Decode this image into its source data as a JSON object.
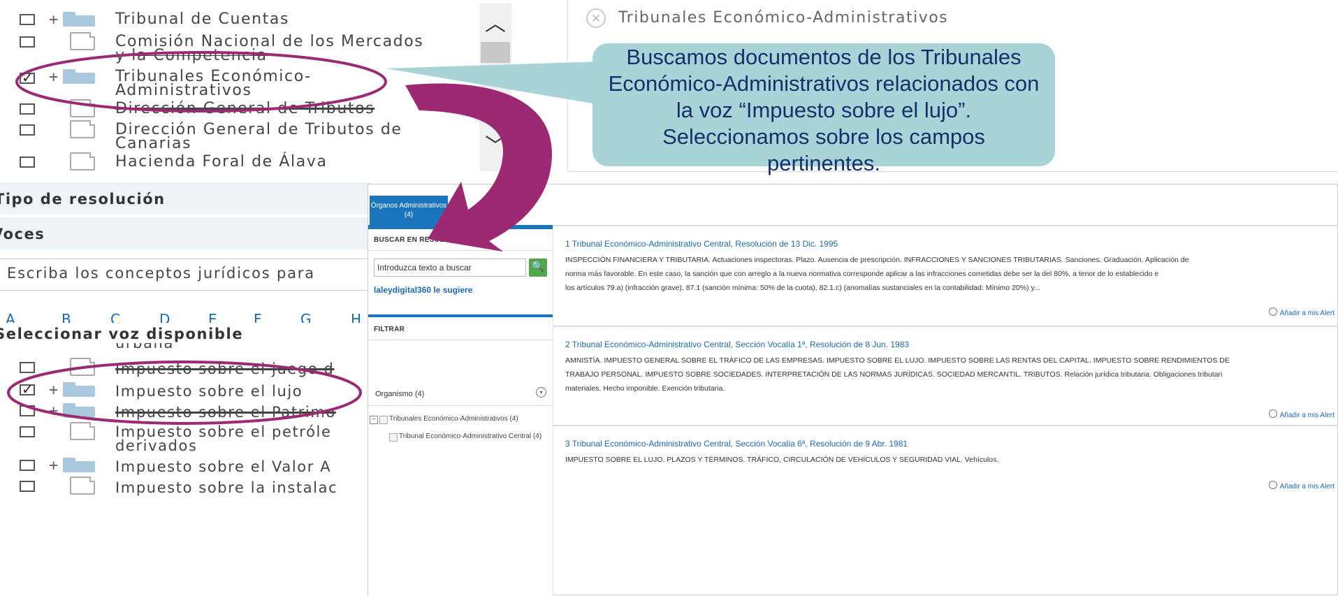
{
  "tree": {
    "items": [
      {
        "label": "Tribunal de Cuentas",
        "label2": ""
      },
      {
        "label": "Comisión Nacional de los Mercados",
        "label2": "y la Competencia"
      },
      {
        "label": "Tribunales Económico-",
        "label2": "Administrativos"
      },
      {
        "label": "Dirección General de Tributos",
        "label2": ""
      },
      {
        "label": "Dirección General de Tributos de",
        "label2": "Canarias"
      },
      {
        "label": "Hacienda Foral de Álava",
        "label2": ""
      }
    ],
    "plus": "+"
  },
  "scroll": {
    "up": "︿",
    "down": "﹀"
  },
  "chip": {
    "close": "✕",
    "label": "Tribunales Económico-Administrativos"
  },
  "callout": {
    "lines": [
      "Buscamos documentos de los Tribunales",
      "Económico-Administrativos relacionados con",
      "la voz “Impuesto sobre el lujo”.",
      "Seleccionamos sobre los campos",
      "pertinentes."
    ]
  },
  "filters": {
    "tipo": "Tipo de resolución",
    "voces": "Voces",
    "concepts_placeholder": "Escriba los conceptos jurídicos para",
    "alphabet": [
      "A",
      "B",
      "C",
      "D",
      "E",
      "F",
      "G",
      "H"
    ],
    "select_voz": "Seleccionar voz disponible",
    "voz_items": [
      {
        "label": "urbana"
      },
      {
        "label": "Impuesto sobre el juego d"
      },
      {
        "label": "Impuesto sobre el lujo"
      },
      {
        "label": "Impuesto sobre el Patrimo"
      },
      {
        "label": "Impuesto sobre el petróle",
        "label2": "derivados"
      },
      {
        "label": "Impuesto sobre el Valor A"
      },
      {
        "label": "Impuesto sobre la instalac"
      }
    ]
  },
  "results_window": {
    "tab": {
      "line1": "Órganos Administrativos",
      "line2": "(4)"
    },
    "sidebar": {
      "buscar_head": "BUSCAR EN RESULTADOS",
      "search_placeholder": "Introduzca texto a buscar",
      "search_icon": "🔍",
      "suggest": "laleydigital360 le sugiere",
      "filtrar_head": "FILTRAR",
      "organismo": "Organismo (4)",
      "toggle": "▾",
      "minus": "−",
      "org_parent": "Tribunales Económico-Administrativos (4)",
      "org_child": "Tribunal Económico-Administrativo Central (4)"
    },
    "results": [
      {
        "title": "1  Tribunal Económico-Administrativo Central, Resolución de 13 Dic. 1995",
        "lines": [
          "INSPECCIÓN FINANCIERA Y TRIBUTARIA. Actuaciones inspectoras. Plazo. Ausencia de prescripción. INFRACCIONES Y SANCIONES TRIBUTARIAS. Sanciones. Graduación. Aplicación de",
          "norma más favorable. En este caso, la sanción que con arreglo a la nueva normativa corresponde aplicar a las infracciones cometidas debe ser la del 80%, a tenor de lo establecido e",
          "los artículos 79.a) (infracción grave), 87.1 (sanción mínima: 50% de la cuota), 82.1.c) (anomalías sustanciales en la contabilidad: Mínimo 20%) y..."
        ],
        "alert": "Añadir a mis Alert"
      },
      {
        "title": "2  Tribunal Económico-Administrativo Central, Sección Vocalía 1ª, Resolución de 8 Jun. 1983",
        "lines": [
          "AMNISTÍA. IMPUESTO GENERAL SOBRE EL TRÁFICO DE LAS EMPRESAS. IMPUESTO SOBRE EL LUJO. IMPUESTO SOBRE LAS RENTAS DEL CAPITAL. IMPUESTO SOBRE RENDIMIENTOS DE",
          "TRABAJO PERSONAL. IMPUESTO SOBRE SOCIEDADES. INTERPRETACIÓN DE LAS NORMAS JURÍDICAS. SOCIEDAD MERCANTIL. TRIBUTOS. Relación jurídica tributaria. Obligaciones tributari",
          "materiales. Hecho imponible. Exención tributaria."
        ],
        "alert": "Añadir a mis Alert"
      },
      {
        "title": "3  Tribunal Económico-Administrativo Central, Sección Vocalía 6ª, Resolución de 9 Abr. 1981",
        "lines": [
          "IMPUESTO SOBRE EL LUJO. PLAZOS Y TÉRMINOS. TRÁFICO, CIRCULACIÓN DE VEHÍCULOS Y SEGURIDAD VIAL. Vehículos."
        ],
        "alert": "Añadir a mis Alert"
      }
    ]
  },
  "colors": {
    "accent_blue": "#1b75bc",
    "callout_bg": "#a8d4d7",
    "callout_text": "#16306b",
    "highlight": "#9b2a73"
  }
}
